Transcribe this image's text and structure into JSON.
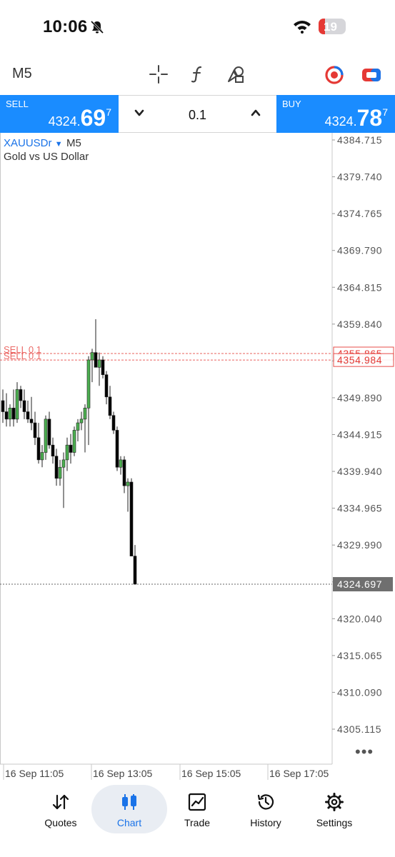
{
  "status_bar": {
    "time": "10:06",
    "battery_level": "19",
    "icons": [
      "bell-muted-icon",
      "wifi-icon",
      "battery-icon"
    ]
  },
  "toolbar": {
    "timeframe": "M5",
    "icons": [
      "crosshair-icon",
      "indicators-icon",
      "objects-icon",
      "account-icon",
      "one-click-trading-icon"
    ]
  },
  "trade": {
    "sell_label": "SELL",
    "sell_price_main": "4324.",
    "sell_price_big": "69",
    "sell_price_sup": "7",
    "buy_label": "BUY",
    "buy_price_main": "4324.",
    "buy_price_big": "78",
    "buy_price_sup": "7",
    "volume": "0.1"
  },
  "chart": {
    "symbol": "XAUUSDr",
    "timeframe": "M5",
    "description": "Gold vs US Dollar",
    "order_lines": [
      {
        "label": "SELL 0.1",
        "price": "4355.865"
      },
      {
        "label": "SELL 0.1",
        "price": "4354.984"
      }
    ],
    "current_price_label": "4324.697"
  },
  "chart_data": {
    "type": "candlestick",
    "y_ticks": [
      "4384.715",
      "4379.740",
      "4374.765",
      "4369.790",
      "4364.815",
      "4359.840",
      "4354.865",
      "4349.890",
      "4344.915",
      "4339.940",
      "4334.965",
      "4329.990",
      "4325.015",
      "4320.040",
      "4315.065",
      "4310.090",
      "4305.115"
    ],
    "y_tick_values": [
      4384.715,
      4379.74,
      4374.765,
      4369.79,
      4364.815,
      4359.84,
      4354.865,
      4349.89,
      4344.915,
      4339.94,
      4334.965,
      4329.99,
      4325.015,
      4320.04,
      4315.065,
      4310.09,
      4305.115
    ],
    "x_labels": [
      "16 Sep 11:05",
      "16 Sep 13:05",
      "16 Sep 15:05",
      "16 Sep 17:05"
    ],
    "ylim": [
      4302.0,
      4388.0
    ],
    "current_price": 4324.697,
    "order_prices": [
      4355.865,
      4354.984
    ],
    "up_color": "#4caf50",
    "down_color": "#000000",
    "candles": [
      {
        "o": 4349.5,
        "h": 4351.0,
        "l": 4346.5,
        "c": 4348.0
      },
      {
        "o": 4348.0,
        "h": 4350.5,
        "l": 4346.0,
        "c": 4347.0
      },
      {
        "o": 4347.0,
        "h": 4349.0,
        "l": 4346.0,
        "c": 4348.5
      },
      {
        "o": 4348.5,
        "h": 4351.0,
        "l": 4346.0,
        "c": 4347.0
      },
      {
        "o": 4347.0,
        "h": 4352.0,
        "l": 4346.5,
        "c": 4351.0
      },
      {
        "o": 4351.0,
        "h": 4351.5,
        "l": 4348.5,
        "c": 4349.5
      },
      {
        "o": 4349.5,
        "h": 4351.0,
        "l": 4347.0,
        "c": 4348.0
      },
      {
        "o": 4348.0,
        "h": 4349.5,
        "l": 4346.5,
        "c": 4347.0
      },
      {
        "o": 4347.0,
        "h": 4350.0,
        "l": 4345.5,
        "c": 4346.5
      },
      {
        "o": 4346.5,
        "h": 4348.0,
        "l": 4343.5,
        "c": 4344.5
      },
      {
        "o": 4344.5,
        "h": 4346.5,
        "l": 4341.0,
        "c": 4341.5
      },
      {
        "o": 4341.5,
        "h": 4343.5,
        "l": 4340.5,
        "c": 4342.5
      },
      {
        "o": 4342.5,
        "h": 4347.5,
        "l": 4341.5,
        "c": 4347.0
      },
      {
        "o": 4347.0,
        "h": 4348.0,
        "l": 4343.0,
        "c": 4343.5
      },
      {
        "o": 4343.5,
        "h": 4344.5,
        "l": 4341.0,
        "c": 4342.0
      },
      {
        "o": 4342.0,
        "h": 4343.0,
        "l": 4338.0,
        "c": 4339.0
      },
      {
        "o": 4339.0,
        "h": 4341.5,
        "l": 4338.0,
        "c": 4340.5
      },
      {
        "o": 4340.5,
        "h": 4342.5,
        "l": 4335.0,
        "c": 4341.5
      },
      {
        "o": 4341.5,
        "h": 4344.5,
        "l": 4340.0,
        "c": 4343.5
      },
      {
        "o": 4343.5,
        "h": 4345.0,
        "l": 4341.0,
        "c": 4342.5
      },
      {
        "o": 4342.5,
        "h": 4346.0,
        "l": 4342.0,
        "c": 4345.5
      },
      {
        "o": 4345.5,
        "h": 4347.0,
        "l": 4344.0,
        "c": 4346.5
      },
      {
        "o": 4346.5,
        "h": 4348.0,
        "l": 4345.5,
        "c": 4347.0
      },
      {
        "o": 4347.0,
        "h": 4349.0,
        "l": 4342.5,
        "c": 4348.5
      },
      {
        "o": 4348.5,
        "h": 4355.5,
        "l": 4343.5,
        "c": 4355.0
      },
      {
        "o": 4355.0,
        "h": 4356.5,
        "l": 4352.0,
        "c": 4356.0
      },
      {
        "o": 4356.0,
        "h": 4360.5,
        "l": 4355.0,
        "c": 4354.0
      },
      {
        "o": 4354.0,
        "h": 4356.0,
        "l": 4351.5,
        "c": 4355.0
      },
      {
        "o": 4355.0,
        "h": 4355.5,
        "l": 4352.5,
        "c": 4353.0
      },
      {
        "o": 4353.0,
        "h": 4353.5,
        "l": 4349.0,
        "c": 4350.0
      },
      {
        "o": 4350.0,
        "h": 4351.5,
        "l": 4347.0,
        "c": 4347.5
      },
      {
        "o": 4347.5,
        "h": 4348.0,
        "l": 4345.0,
        "c": 4345.5
      },
      {
        "o": 4345.5,
        "h": 4346.0,
        "l": 4340.0,
        "c": 4340.5
      },
      {
        "o": 4340.5,
        "h": 4342.0,
        "l": 4339.5,
        "c": 4341.5
      },
      {
        "o": 4341.5,
        "h": 4342.0,
        "l": 4337.0,
        "c": 4338.0
      },
      {
        "o": 4338.0,
        "h": 4339.0,
        "l": 4334.5,
        "c": 4338.5
      },
      {
        "o": 4338.5,
        "h": 4339.0,
        "l": 4328.5,
        "c": 4328.5
      },
      {
        "o": 4328.5,
        "h": 4330.0,
        "l": 4324.7,
        "c": 4324.7
      }
    ]
  },
  "nav": {
    "items": [
      {
        "label": "Quotes",
        "icon": "quotes-arrows-icon"
      },
      {
        "label": "Chart",
        "icon": "candlestick-chart-icon",
        "active": true
      },
      {
        "label": "Trade",
        "icon": "trade-graph-icon"
      },
      {
        "label": "History",
        "icon": "history-clock-icon"
      },
      {
        "label": "Settings",
        "icon": "settings-gear-icon"
      }
    ]
  },
  "colors": {
    "accent": "#1a8cff",
    "order_line": "#e53935",
    "active_nav": "#1a73e8"
  }
}
